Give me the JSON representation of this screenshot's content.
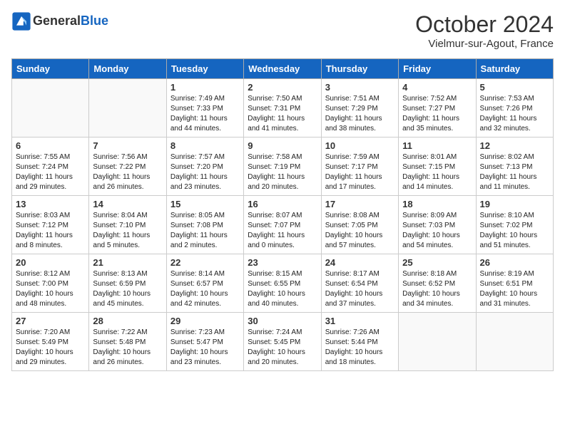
{
  "header": {
    "logo_general": "General",
    "logo_blue": "Blue",
    "month_title": "October 2024",
    "subtitle": "Vielmur-sur-Agout, France"
  },
  "days_of_week": [
    "Sunday",
    "Monday",
    "Tuesday",
    "Wednesday",
    "Thursday",
    "Friday",
    "Saturday"
  ],
  "weeks": [
    [
      {
        "day": "",
        "empty": true
      },
      {
        "day": "",
        "empty": true
      },
      {
        "day": "1",
        "sunrise": "Sunrise: 7:49 AM",
        "sunset": "Sunset: 7:33 PM",
        "daylight": "Daylight: 11 hours and 44 minutes."
      },
      {
        "day": "2",
        "sunrise": "Sunrise: 7:50 AM",
        "sunset": "Sunset: 7:31 PM",
        "daylight": "Daylight: 11 hours and 41 minutes."
      },
      {
        "day": "3",
        "sunrise": "Sunrise: 7:51 AM",
        "sunset": "Sunset: 7:29 PM",
        "daylight": "Daylight: 11 hours and 38 minutes."
      },
      {
        "day": "4",
        "sunrise": "Sunrise: 7:52 AM",
        "sunset": "Sunset: 7:27 PM",
        "daylight": "Daylight: 11 hours and 35 minutes."
      },
      {
        "day": "5",
        "sunrise": "Sunrise: 7:53 AM",
        "sunset": "Sunset: 7:26 PM",
        "daylight": "Daylight: 11 hours and 32 minutes."
      }
    ],
    [
      {
        "day": "6",
        "sunrise": "Sunrise: 7:55 AM",
        "sunset": "Sunset: 7:24 PM",
        "daylight": "Daylight: 11 hours and 29 minutes."
      },
      {
        "day": "7",
        "sunrise": "Sunrise: 7:56 AM",
        "sunset": "Sunset: 7:22 PM",
        "daylight": "Daylight: 11 hours and 26 minutes."
      },
      {
        "day": "8",
        "sunrise": "Sunrise: 7:57 AM",
        "sunset": "Sunset: 7:20 PM",
        "daylight": "Daylight: 11 hours and 23 minutes."
      },
      {
        "day": "9",
        "sunrise": "Sunrise: 7:58 AM",
        "sunset": "Sunset: 7:19 PM",
        "daylight": "Daylight: 11 hours and 20 minutes."
      },
      {
        "day": "10",
        "sunrise": "Sunrise: 7:59 AM",
        "sunset": "Sunset: 7:17 PM",
        "daylight": "Daylight: 11 hours and 17 minutes."
      },
      {
        "day": "11",
        "sunrise": "Sunrise: 8:01 AM",
        "sunset": "Sunset: 7:15 PM",
        "daylight": "Daylight: 11 hours and 14 minutes."
      },
      {
        "day": "12",
        "sunrise": "Sunrise: 8:02 AM",
        "sunset": "Sunset: 7:13 PM",
        "daylight": "Daylight: 11 hours and 11 minutes."
      }
    ],
    [
      {
        "day": "13",
        "sunrise": "Sunrise: 8:03 AM",
        "sunset": "Sunset: 7:12 PM",
        "daylight": "Daylight: 11 hours and 8 minutes."
      },
      {
        "day": "14",
        "sunrise": "Sunrise: 8:04 AM",
        "sunset": "Sunset: 7:10 PM",
        "daylight": "Daylight: 11 hours and 5 minutes."
      },
      {
        "day": "15",
        "sunrise": "Sunrise: 8:05 AM",
        "sunset": "Sunset: 7:08 PM",
        "daylight": "Daylight: 11 hours and 2 minutes."
      },
      {
        "day": "16",
        "sunrise": "Sunrise: 8:07 AM",
        "sunset": "Sunset: 7:07 PM",
        "daylight": "Daylight: 11 hours and 0 minutes."
      },
      {
        "day": "17",
        "sunrise": "Sunrise: 8:08 AM",
        "sunset": "Sunset: 7:05 PM",
        "daylight": "Daylight: 10 hours and 57 minutes."
      },
      {
        "day": "18",
        "sunrise": "Sunrise: 8:09 AM",
        "sunset": "Sunset: 7:03 PM",
        "daylight": "Daylight: 10 hours and 54 minutes."
      },
      {
        "day": "19",
        "sunrise": "Sunrise: 8:10 AM",
        "sunset": "Sunset: 7:02 PM",
        "daylight": "Daylight: 10 hours and 51 minutes."
      }
    ],
    [
      {
        "day": "20",
        "sunrise": "Sunrise: 8:12 AM",
        "sunset": "Sunset: 7:00 PM",
        "daylight": "Daylight: 10 hours and 48 minutes."
      },
      {
        "day": "21",
        "sunrise": "Sunrise: 8:13 AM",
        "sunset": "Sunset: 6:59 PM",
        "daylight": "Daylight: 10 hours and 45 minutes."
      },
      {
        "day": "22",
        "sunrise": "Sunrise: 8:14 AM",
        "sunset": "Sunset: 6:57 PM",
        "daylight": "Daylight: 10 hours and 42 minutes."
      },
      {
        "day": "23",
        "sunrise": "Sunrise: 8:15 AM",
        "sunset": "Sunset: 6:55 PM",
        "daylight": "Daylight: 10 hours and 40 minutes."
      },
      {
        "day": "24",
        "sunrise": "Sunrise: 8:17 AM",
        "sunset": "Sunset: 6:54 PM",
        "daylight": "Daylight: 10 hours and 37 minutes."
      },
      {
        "day": "25",
        "sunrise": "Sunrise: 8:18 AM",
        "sunset": "Sunset: 6:52 PM",
        "daylight": "Daylight: 10 hours and 34 minutes."
      },
      {
        "day": "26",
        "sunrise": "Sunrise: 8:19 AM",
        "sunset": "Sunset: 6:51 PM",
        "daylight": "Daylight: 10 hours and 31 minutes."
      }
    ],
    [
      {
        "day": "27",
        "sunrise": "Sunrise: 7:20 AM",
        "sunset": "Sunset: 5:49 PM",
        "daylight": "Daylight: 10 hours and 29 minutes."
      },
      {
        "day": "28",
        "sunrise": "Sunrise: 7:22 AM",
        "sunset": "Sunset: 5:48 PM",
        "daylight": "Daylight: 10 hours and 26 minutes."
      },
      {
        "day": "29",
        "sunrise": "Sunrise: 7:23 AM",
        "sunset": "Sunset: 5:47 PM",
        "daylight": "Daylight: 10 hours and 23 minutes."
      },
      {
        "day": "30",
        "sunrise": "Sunrise: 7:24 AM",
        "sunset": "Sunset: 5:45 PM",
        "daylight": "Daylight: 10 hours and 20 minutes."
      },
      {
        "day": "31",
        "sunrise": "Sunrise: 7:26 AM",
        "sunset": "Sunset: 5:44 PM",
        "daylight": "Daylight: 10 hours and 18 minutes."
      },
      {
        "day": "",
        "empty": true
      },
      {
        "day": "",
        "empty": true
      }
    ]
  ]
}
